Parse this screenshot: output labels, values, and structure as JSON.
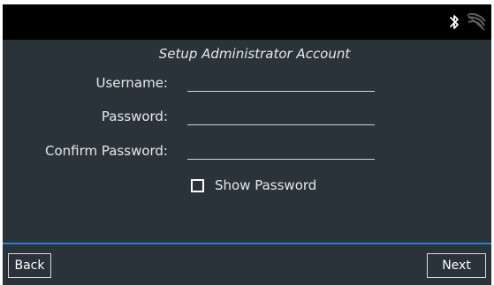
{
  "status_bar": {
    "icons": [
      "bluetooth-icon",
      "wifi-icon"
    ]
  },
  "form": {
    "title": "Setup Administrator Account",
    "username": {
      "label": "Username:",
      "value": ""
    },
    "password": {
      "label": "Password:",
      "value": ""
    },
    "confirm_password": {
      "label": "Confirm Password:",
      "value": ""
    },
    "show_password": {
      "label": "Show Password",
      "checked": false
    }
  },
  "footer": {
    "back_label": "Back",
    "next_label": "Next"
  },
  "colors": {
    "background": "#2a3339",
    "status_bar": "#000000",
    "accent_line": "#2f7fd1",
    "text": "#e6e8ea"
  }
}
